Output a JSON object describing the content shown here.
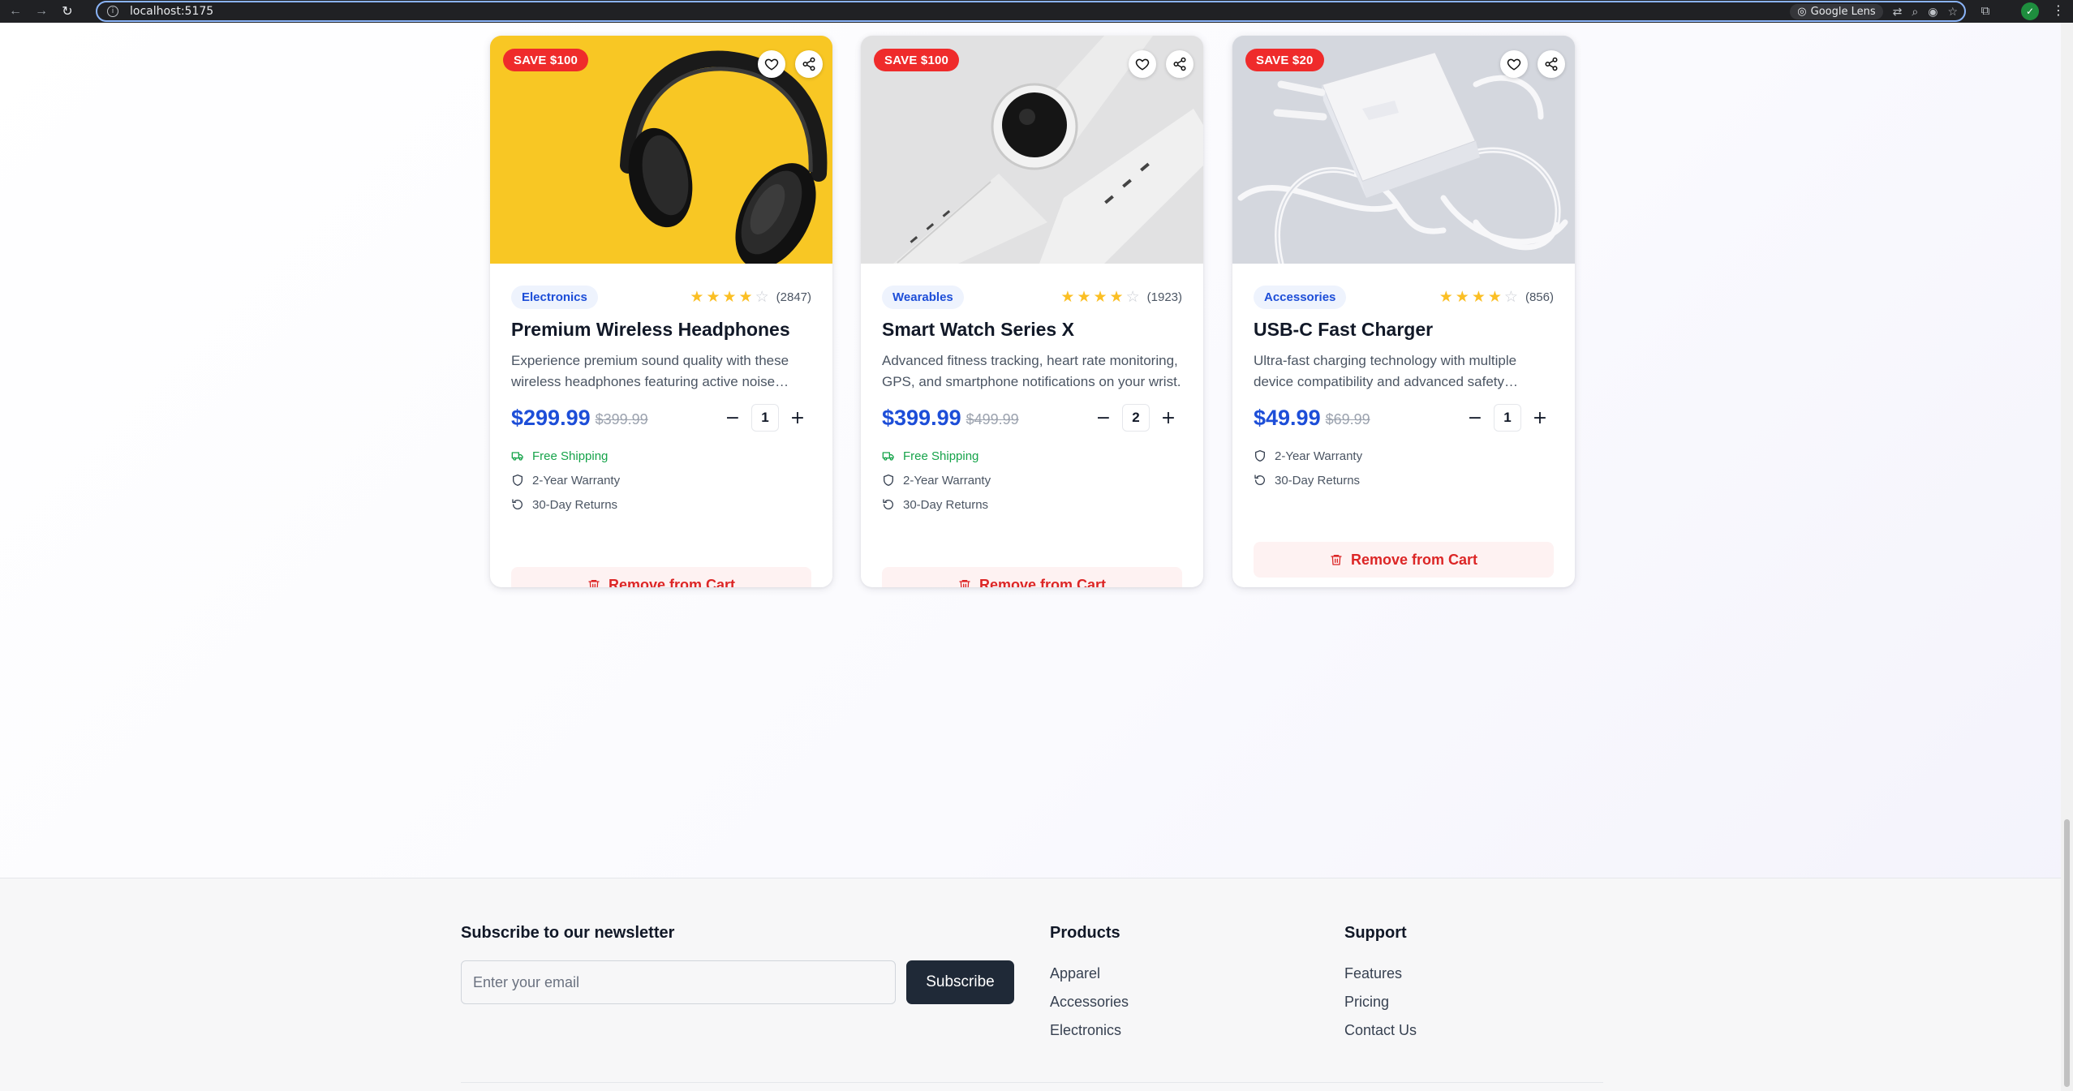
{
  "browser": {
    "url": "localhost:5175",
    "lens_label": "Google Lens"
  },
  "colors": {
    "accent_blue": "#1d4ed8",
    "sale_red": "#ef2b2b",
    "success_green": "#16a34a",
    "star_yellow": "#fbbf24",
    "remove_red": "#dc2626",
    "dark_button": "#1f2937"
  },
  "products": [
    {
      "badge": "SAVE $100",
      "category": "Electronics",
      "rating": 4,
      "reviews": "(2847)",
      "title": "Premium Wireless Headphones",
      "description": "Experience premium sound quality with these wireless headphones featuring active noise cancellation and long battery life.",
      "price": "$299.99",
      "old_price": "$399.99",
      "quantity": "1",
      "features": [
        {
          "icon": "truck-icon",
          "text": "Free Shipping",
          "highlight": true
        },
        {
          "icon": "shield-icon",
          "text": "2-Year Warranty",
          "highlight": false
        },
        {
          "icon": "rotate-icon",
          "text": "30-Day Returns",
          "highlight": false
        }
      ],
      "remove_label": "Remove from Cart"
    },
    {
      "badge": "SAVE $100",
      "category": "Wearables",
      "rating": 4,
      "reviews": "(1923)",
      "title": "Smart Watch Series X",
      "description": "Advanced fitness tracking, heart rate monitoring, GPS, and smartphone notifications on your wrist.",
      "price": "$399.99",
      "old_price": "$499.99",
      "quantity": "2",
      "features": [
        {
          "icon": "truck-icon",
          "text": "Free Shipping",
          "highlight": true
        },
        {
          "icon": "shield-icon",
          "text": "2-Year Warranty",
          "highlight": false
        },
        {
          "icon": "rotate-icon",
          "text": "30-Day Returns",
          "highlight": false
        }
      ],
      "remove_label": "Remove from Cart"
    },
    {
      "badge": "SAVE $20",
      "category": "Accessories",
      "rating": 4,
      "reviews": "(856)",
      "title": "USB-C Fast Charger",
      "description": "Ultra-fast charging technology with multiple device compatibility and advanced safety features.",
      "price": "$49.99",
      "old_price": "$69.99",
      "quantity": "1",
      "features": [
        {
          "icon": "shield-icon",
          "text": "2-Year Warranty",
          "highlight": false
        },
        {
          "icon": "rotate-icon",
          "text": "30-Day Returns",
          "highlight": false
        }
      ],
      "remove_label": "Remove from Cart"
    }
  ],
  "footer": {
    "newsletter": {
      "title": "Subscribe to our newsletter",
      "placeholder": "Enter your email",
      "button": "Subscribe"
    },
    "products": {
      "title": "Products",
      "links": [
        "Apparel",
        "Accessories",
        "Electronics"
      ]
    },
    "support": {
      "title": "Support",
      "links": [
        "Features",
        "Pricing",
        "Contact Us"
      ]
    }
  }
}
